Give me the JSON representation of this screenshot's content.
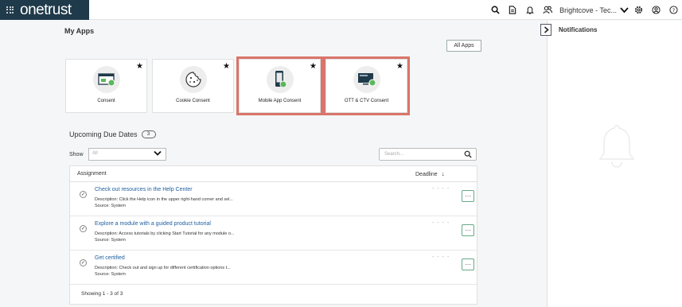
{
  "topbar": {
    "brand": "onetrust",
    "org_name": "Brightcove - Tec...",
    "icons": [
      "search-icon",
      "document-icon",
      "bell-icon",
      "users-icon",
      "chevron-down-icon",
      "settings-icon",
      "account-icon",
      "help-icon"
    ]
  },
  "main": {
    "title": "My Apps",
    "all_apps": "All Apps",
    "apps": [
      {
        "label": "Consent",
        "icon": "consent-icon"
      },
      {
        "label": "Cookie Consent",
        "icon": "cookie-icon"
      },
      {
        "label": "Mobile App Consent",
        "icon": "mobile-icon"
      },
      {
        "label": "OTT & CTV Consent",
        "icon": "tv-icon"
      }
    ],
    "upcoming": {
      "title": "Upcoming Due Dates",
      "count": "3"
    },
    "filter": {
      "show_label": "Show",
      "select_value": "All",
      "search_placeholder": "Search..."
    },
    "table": {
      "headers": {
        "assignment": "Assignment",
        "deadline": "Deadline"
      },
      "rows": [
        {
          "title": "Check out resources in the Help Center",
          "desc": "Description:  Click the Help icon in the upper right-hand corner and sel...",
          "source": "Source:  System",
          "deadline": "- - - -"
        },
        {
          "title": "Explore a module with a guided product tutorial",
          "desc": "Description:  Access tutorials by clicking Start Tutorial for any module o...",
          "source": "Source:  System",
          "deadline": "- - - -"
        },
        {
          "title": "Get certified",
          "desc": "Description:  Check out and sign up for different certification options t...",
          "source": "Source:  System",
          "deadline": "- - - -"
        }
      ],
      "footer": "Showing 1 - 3 of 3"
    }
  },
  "notifications": {
    "title": "Notifications"
  },
  "colors": {
    "brand_bg": "#1f3a4a",
    "highlight": "#d9756a",
    "link": "#1f5fa0",
    "check": "#5cb85c"
  }
}
